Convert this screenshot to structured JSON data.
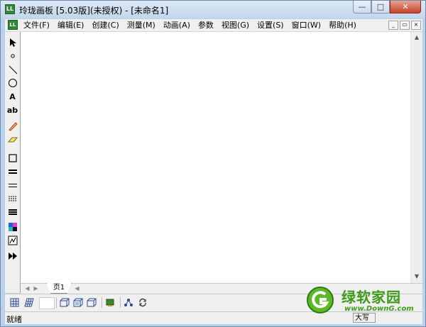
{
  "window": {
    "title": "玲珑画板 [5.03版](未授权) - [未命名1]",
    "icon_text": "LL",
    "controls": {
      "minimize": "—",
      "maximize": "□",
      "close": "✕"
    }
  },
  "menu": {
    "items": [
      "文件(F)",
      "编辑(E)",
      "创建(C)",
      "测量(M)",
      "动画(A)",
      "参数",
      "视图(G)",
      "设置(S)",
      "窗口(W)",
      "帮助(H)"
    ],
    "mdi": {
      "minimize": "_",
      "restore": "▭",
      "close": "×"
    }
  },
  "tools": {
    "text_tool": "A",
    "label_tool": "ab"
  },
  "page_tabs": {
    "current": "页1"
  },
  "status": {
    "text": "就绪",
    "caps": "大写"
  },
  "watermark": {
    "name": "绿软家园",
    "url": "www.DownG.com"
  },
  "colors": {
    "accent_green": "#3e9a1a",
    "app_icon": "#2f8a3a",
    "close_button": "#c8432a"
  }
}
